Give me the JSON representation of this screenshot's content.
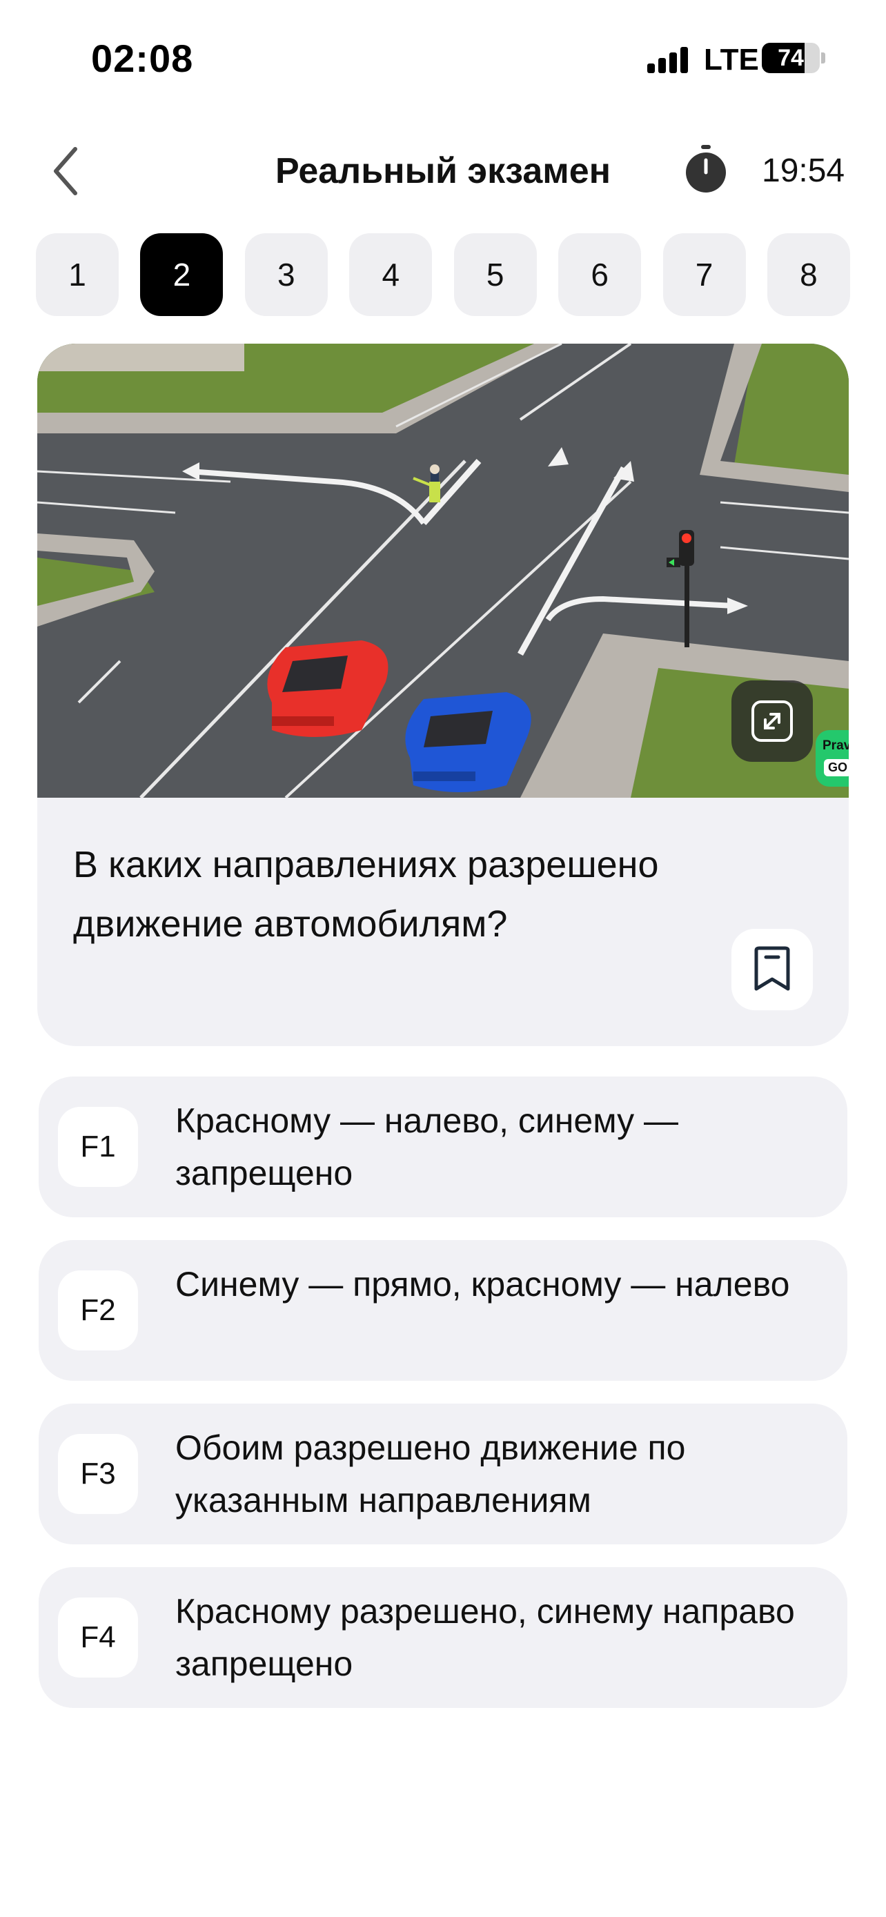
{
  "status_bar": {
    "time": "02:08",
    "network": "LTE",
    "battery_level": "74",
    "battery_fraction": 0.74
  },
  "header": {
    "back_icon": "chevron-left-icon",
    "title": "Реальный экзамен",
    "timer_icon": "stopwatch-icon",
    "timer_value": "19:54"
  },
  "question_numbers": {
    "items": [
      "1",
      "2",
      "3",
      "4",
      "5",
      "6",
      "7",
      "8"
    ],
    "active": "2"
  },
  "question": {
    "image_description_icon": "intersection-scene-image",
    "expand_icon": "expand-icon",
    "watermark_line1": "Prava",
    "watermark_line2": "GO",
    "text": "В каких направлениях разрешено движение автомобилям?",
    "bookmark_icon": "bookmark-icon"
  },
  "answers": [
    {
      "key": "F1",
      "text": "Красному — налево, синему — запрещено"
    },
    {
      "key": "F2",
      "text": "Синему — прямо, красному — налево"
    },
    {
      "key": "F3",
      "text": "Обоим разрешено движение по указанным направлениям"
    },
    {
      "key": "F4",
      "text": "Красному разрешено, синему направо запрещено"
    }
  ],
  "colors": {
    "active_number_bg": "#000000",
    "card_bg": "#f1f1f5",
    "watermark_green": "#24c86c"
  }
}
